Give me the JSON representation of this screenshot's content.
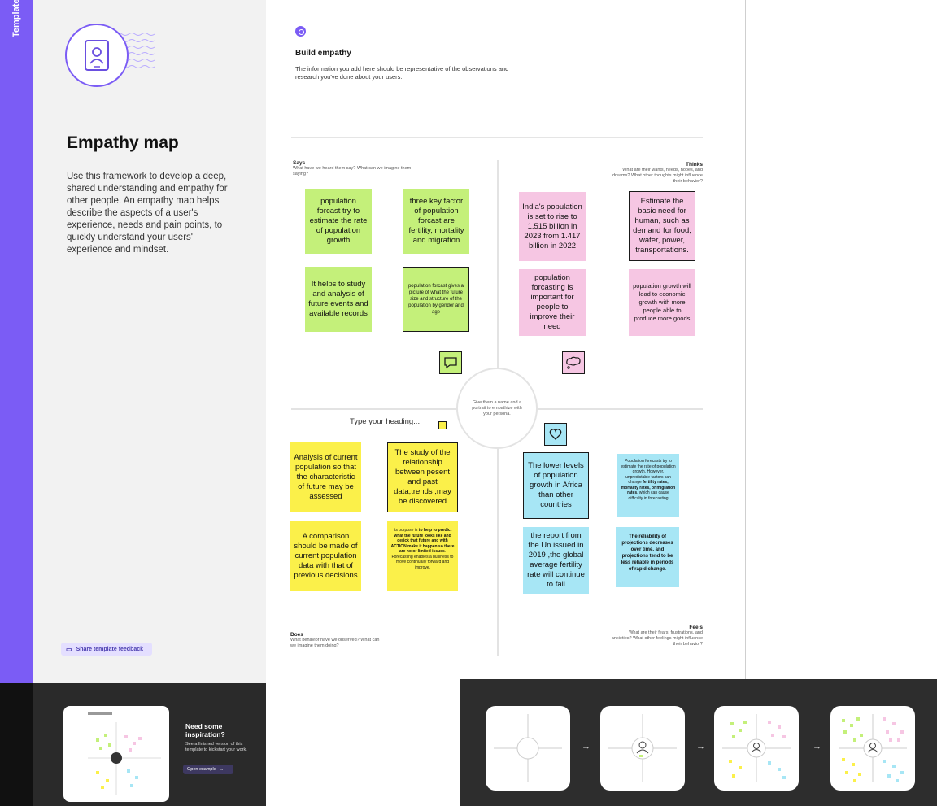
{
  "sidebar": {
    "tab_label": "Template"
  },
  "panel": {
    "title": "Empathy map",
    "description": "Use this framework to develop a deep, shared understanding and empathy for other people. An empathy map helps describe the aspects of a user's experience, needs and pain points, to quickly understand your users' experience and mindset.",
    "feedback_label": "Share template feedback"
  },
  "inspiration": {
    "title": "Need some inspiration?",
    "text": "See a finished version of this template to kickstart your work.",
    "button_label": "Open example"
  },
  "board": {
    "step_title": "Build empathy",
    "step_desc": "The information you add here should be representative of the observations and research you've done about your users.",
    "center_text": "Give them a name and a portrait to empathize with your persona.",
    "heading_placeholder": "Type your heading...",
    "says": {
      "title": "Says",
      "sub": "What have we heard them say? What can we imagine them saying?"
    },
    "thinks": {
      "title": "Thinks",
      "sub": "What are their wants, needs, hopes, and dreams? What other thoughts might influence their behavior?"
    },
    "does": {
      "title": "Does",
      "sub": "What behavior have we observed? What can we imagine them doing?"
    },
    "feels": {
      "title": "Feels",
      "sub": "What are their fears, frustrations, and anxieties? What other feelings might influence their behavior?"
    }
  },
  "notes": {
    "g1": "population forcast try to estimate the rate of population growth",
    "g2": "three key factor of population forcast are fertility, mortality and migration",
    "g3": "It helps to study and analysis of future events and available records",
    "g4": "population forcast gives a picture of what the future size and structure of the population by gender and age",
    "p1": "India's population is set to rise to 1.515 billion in 2023 from 1.417 billion in 2022",
    "p2": "Estimate the basic need for human, such as demand for food, water, power, transportations.",
    "p3": "population forcasting is important for people to improve their need",
    "p4": "population growth will lead to economic growth with more people able to produce more goods",
    "y1": "Analysis of current population so that the characteristic of future may be assessed",
    "y2": "The study of the relationship between pesent and past data,trends ,may be discovered",
    "y3": "A comparison should be made of current population data with that of previous decisions",
    "y4_pre": "Its purpose is ",
    "y4_bold": "to help to predict what the future looks like and derick that future and with ACTION make it happen so there are no or limited issues",
    "y4_post": ". Forecasting enables a business to move continually forward and improve.",
    "b1": "The lower levels of population growth in Africa than other countries",
    "b2_pre": "Population forecasts try to estimate the rate of population growth. However, unpredictable factors can change ",
    "b2_bold": "fertility rates, mortality rates, or migration rates",
    "b2_post": ", which can cause difficulty in forecasting",
    "b3": "the report from the Un issued in 2019 ,the global average fertility rate will continue to fall",
    "b4_bold": "The reliability of projections decreases over time, and projections tend to be less reliable in periods of rapid change",
    "b4_post": "."
  },
  "colors": {
    "accent": "#7b5cf5",
    "green": "#c4f07a",
    "pink": "#f6c6e3",
    "yellow": "#fbf04a",
    "blue": "#a7e6f5"
  },
  "icons": [
    "tablet-person-icon",
    "speech-bubble-icon",
    "thought-bubble-icon",
    "heart-icon",
    "arrow-right-icon",
    "chat-icon"
  ]
}
